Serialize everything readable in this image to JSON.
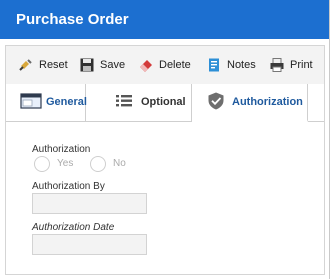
{
  "window": {
    "title": "Purchase Order"
  },
  "toolbar": {
    "reset_label": "Reset",
    "save_label": "Save",
    "delete_label": "Delete",
    "notes_label": "Notes",
    "print_label": "Print"
  },
  "tabs": [
    {
      "label": "General",
      "icon": "window-icon",
      "active": false
    },
    {
      "label": "Optional",
      "icon": "list-icon",
      "active": false
    },
    {
      "label": "Authorization",
      "icon": "shield-check-icon",
      "active": true
    }
  ],
  "form": {
    "authorization": {
      "label": "Authorization",
      "options": [
        {
          "label": "Yes",
          "selected": false
        },
        {
          "label": "No",
          "selected": false
        }
      ]
    },
    "authorization_by": {
      "label": "Authorization By",
      "value": ""
    },
    "authorization_date": {
      "label": "Authorization Date",
      "value": ""
    }
  },
  "colors": {
    "titlebar": "#1c6fd0",
    "tab_text": "#1f5a9e",
    "toolbar_bg": "#f3f3f3",
    "disabled_input": "#f3f3f3"
  }
}
